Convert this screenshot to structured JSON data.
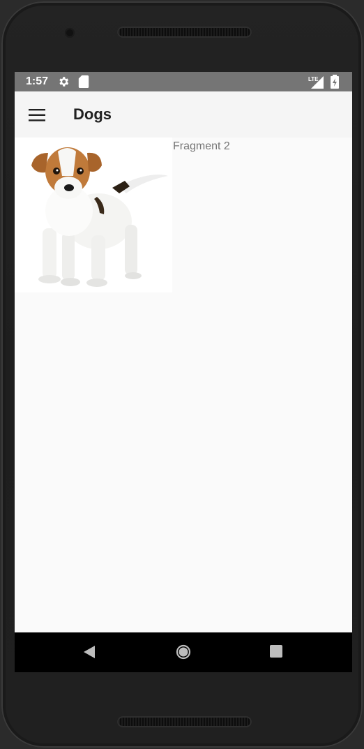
{
  "status_bar": {
    "time": "1:57",
    "icons": [
      "settings-icon",
      "sd-card-icon",
      "lte-signal-icon",
      "battery-charging-icon"
    ],
    "network_label": "LTE"
  },
  "app_bar": {
    "menu_icon": "hamburger-menu-icon",
    "title": "Dogs"
  },
  "content": {
    "image_subject": "puppy",
    "fragment_label": "Fragment 2"
  },
  "nav_bar": {
    "buttons": [
      "back-icon",
      "home-icon",
      "recents-icon"
    ]
  },
  "colors": {
    "status_bar": "#757575",
    "app_bar": "#f5f5f5",
    "background": "#fafafa",
    "nav_bar": "#000000"
  }
}
